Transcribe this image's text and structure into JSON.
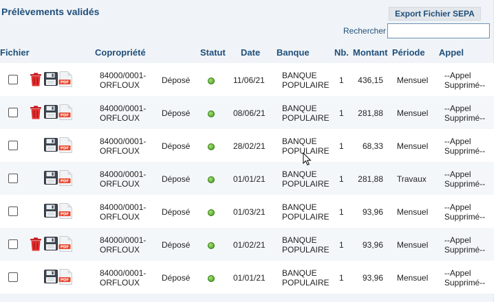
{
  "header": {
    "title": "Prélèvements validés",
    "export_label": "Export Fichier SEPA",
    "search_label": "Rechercher",
    "search_value": ""
  },
  "columns": {
    "fichier": "Fichier",
    "copropriete": "Copropriété",
    "statut": "Statut",
    "date": "Date",
    "banque": "Banque",
    "nb": "Nb.",
    "montant": "Montant",
    "periode": "Période",
    "appel": "Appel"
  },
  "rows": [
    {
      "copro_line1": "84000/0001-",
      "copro_line2": "ORFLOUX",
      "etat": "Déposé",
      "date": "11/06/21",
      "banque_line1": "BANQUE",
      "banque_line2": "POPULAIRE",
      "nb": "1",
      "montant": "436,15",
      "periode": "Mensuel",
      "appel_line1": "--Appel",
      "appel_line2": "Supprimé--",
      "has_trash": true
    },
    {
      "copro_line1": "84000/0001-",
      "copro_line2": "ORFLOUX",
      "etat": "Déposé",
      "date": "08/06/21",
      "banque_line1": "BANQUE",
      "banque_line2": "POPULAIRE",
      "nb": "1",
      "montant": "281,88",
      "periode": "Mensuel",
      "appel_line1": "--Appel",
      "appel_line2": "Supprimé--",
      "has_trash": true
    },
    {
      "copro_line1": "84000/0001-",
      "copro_line2": "ORFLOUX",
      "etat": "Déposé",
      "date": "28/02/21",
      "banque_line1": "BANQUE",
      "banque_line2": "POPULAIRE",
      "nb": "1",
      "montant": "68,33",
      "periode": "Mensuel",
      "appel_line1": "--Appel",
      "appel_line2": "Supprimé--",
      "has_trash": false
    },
    {
      "copro_line1": "84000/0001-",
      "copro_line2": "ORFLOUX",
      "etat": "Déposé",
      "date": "01/01/21",
      "banque_line1": "BANQUE",
      "banque_line2": "POPULAIRE",
      "nb": "1",
      "montant": "281,88",
      "periode": "Travaux",
      "appel_line1": "--Appel",
      "appel_line2": "Supprimé--",
      "has_trash": false
    },
    {
      "copro_line1": "84000/0001-",
      "copro_line2": "ORFLOUX",
      "etat": "Déposé",
      "date": "01/03/21",
      "banque_line1": "BANQUE",
      "banque_line2": "POPULAIRE",
      "nb": "1",
      "montant": "93,96",
      "periode": "Mensuel",
      "appel_line1": "--Appel",
      "appel_line2": "Supprimé--",
      "has_trash": false
    },
    {
      "copro_line1": "84000/0001-",
      "copro_line2": "ORFLOUX",
      "etat": "Déposé",
      "date": "01/02/21",
      "banque_line1": "BANQUE",
      "banque_line2": "POPULAIRE",
      "nb": "1",
      "montant": "93,96",
      "periode": "Mensuel",
      "appel_line1": "--Appel",
      "appel_line2": "Supprimé--",
      "has_trash": true
    },
    {
      "copro_line1": "84000/0001-",
      "copro_line2": "ORFLOUX",
      "etat": "Déposé",
      "date": "01/01/21",
      "banque_line1": "BANQUE",
      "banque_line2": "POPULAIRE",
      "nb": "1",
      "montant": "93,96",
      "periode": "Mensuel",
      "appel_line1": "--Appel",
      "appel_line2": "Supprimé--",
      "has_trash": false
    }
  ],
  "icons": {
    "row_actions": [
      "trash-icon",
      "floppy-disk-icon",
      "pdf-icon"
    ],
    "status": "green-dot-icon"
  },
  "colors": {
    "accent": "#1f4e79",
    "status_ok": "#3e9a1a",
    "trash": "#d9262b",
    "pdf_badge": "#e8452c"
  }
}
